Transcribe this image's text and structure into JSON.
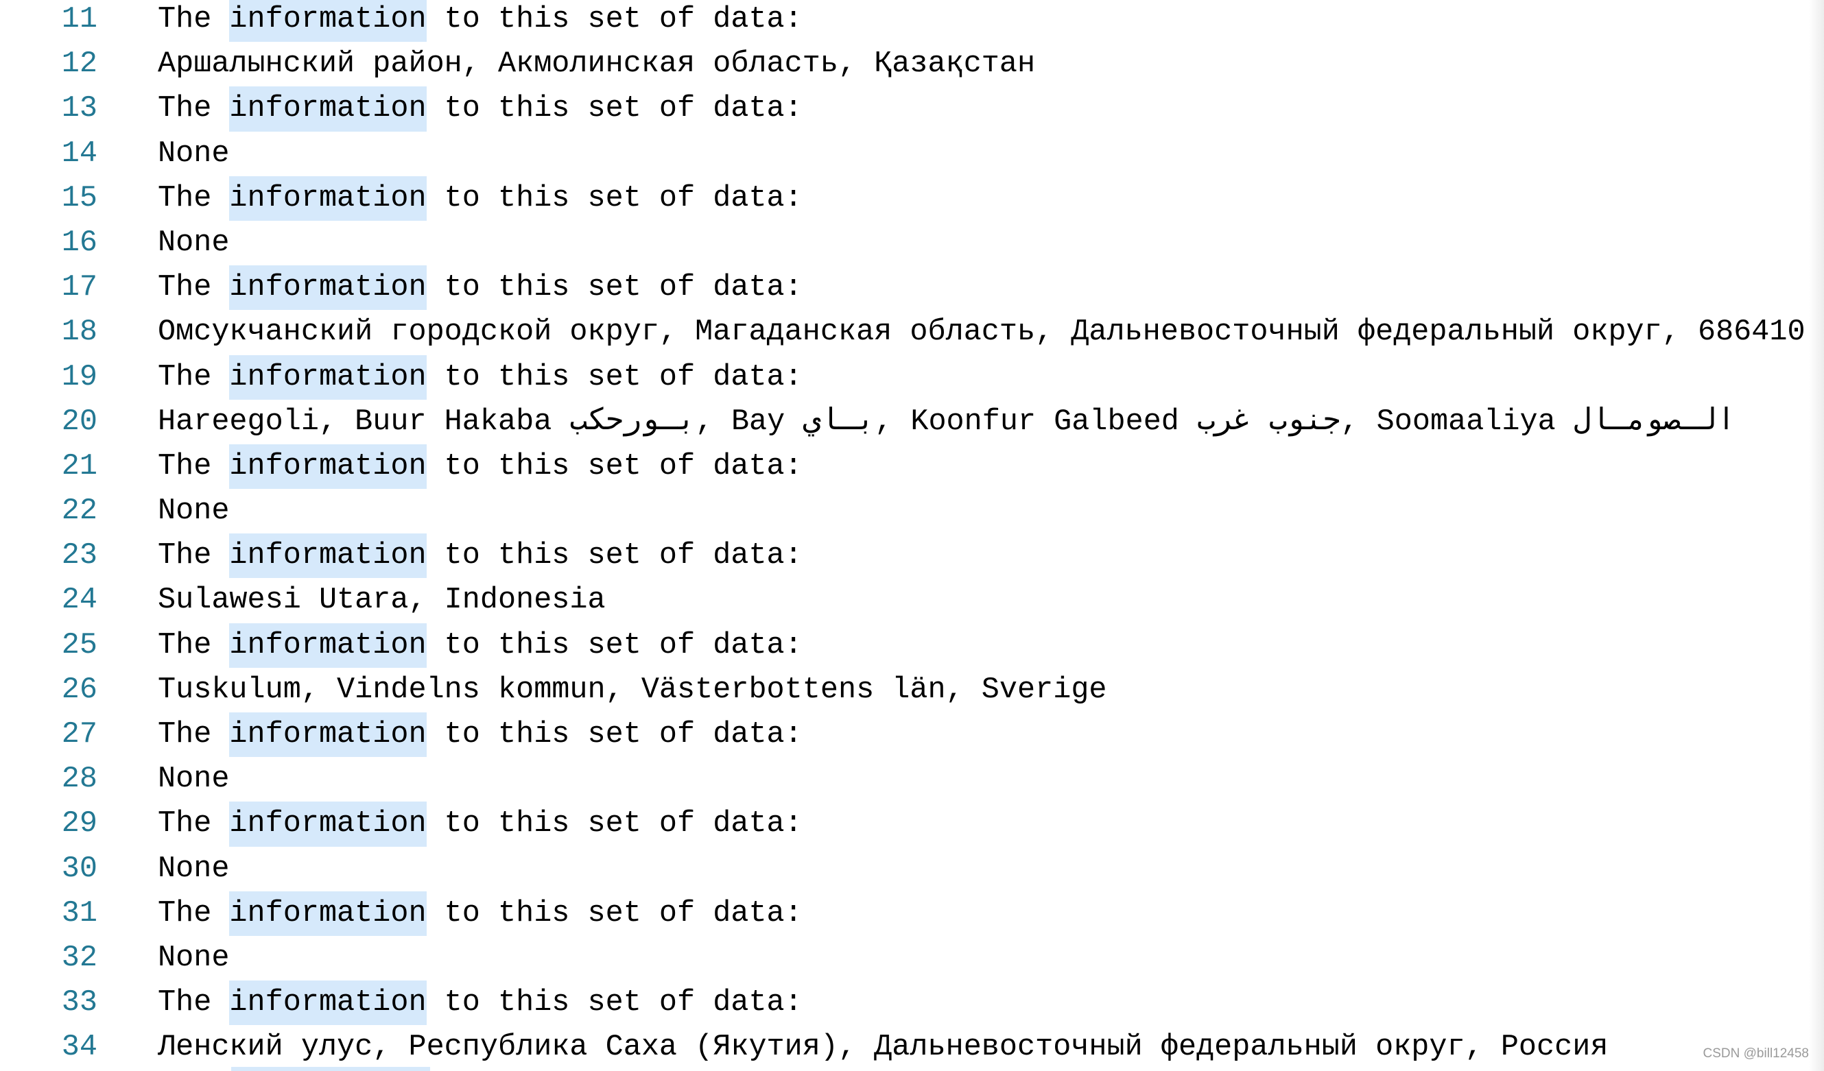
{
  "editor": {
    "highlight_color": "#d6e9fb",
    "line_number_color": "#237893",
    "highlighted_word": "information",
    "lines": [
      {
        "number": "11",
        "type": "header",
        "before": "The ",
        "highlight": "information",
        "after": " to this set of data:"
      },
      {
        "number": "12",
        "type": "value",
        "text": "Аршалынский район, Акмолинская область, Қазақстан"
      },
      {
        "number": "13",
        "type": "header",
        "before": "The ",
        "highlight": "information",
        "after": " to this set of data:"
      },
      {
        "number": "14",
        "type": "value",
        "text": "None"
      },
      {
        "number": "15",
        "type": "header",
        "before": "The ",
        "highlight": "information",
        "after": " to this set of data:"
      },
      {
        "number": "16",
        "type": "value",
        "text": "None"
      },
      {
        "number": "17",
        "type": "header",
        "before": "The ",
        "highlight": "information",
        "after": " to this set of data:"
      },
      {
        "number": "18",
        "type": "value",
        "text": "Омсукчанский городской округ, Магаданская область, Дальневосточный федеральный округ, 686410"
      },
      {
        "number": "19",
        "type": "header",
        "before": "The ",
        "highlight": "information",
        "after": " to this set of data:"
      },
      {
        "number": "20",
        "type": "value",
        "text": "Hareegoli, Buur Hakaba ⁧بـورحكب⁩, Bay ⁧بـاي⁩, Koonfur Galbeed ⁧جنوب غرب⁩, Soomaaliya ⁧الـصومـال⁩"
      },
      {
        "number": "21",
        "type": "header",
        "before": "The ",
        "highlight": "information",
        "after": " to this set of data:"
      },
      {
        "number": "22",
        "type": "value",
        "text": "None"
      },
      {
        "number": "23",
        "type": "header",
        "before": "The ",
        "highlight": "information",
        "after": " to this set of data:"
      },
      {
        "number": "24",
        "type": "value",
        "text": "Sulawesi Utara, Indonesia"
      },
      {
        "number": "25",
        "type": "header",
        "before": "The ",
        "highlight": "information",
        "after": " to this set of data:"
      },
      {
        "number": "26",
        "type": "value",
        "text": "Tuskulum, Vindelns kommun, Västerbottens län, Sverige"
      },
      {
        "number": "27",
        "type": "header",
        "before": "The ",
        "highlight": "information",
        "after": " to this set of data:"
      },
      {
        "number": "28",
        "type": "value",
        "text": "None"
      },
      {
        "number": "29",
        "type": "header",
        "before": "The ",
        "highlight": "information",
        "after": " to this set of data:"
      },
      {
        "number": "30",
        "type": "value",
        "text": "None"
      },
      {
        "number": "31",
        "type": "header",
        "before": "The ",
        "highlight": "information",
        "after": " to this set of data:"
      },
      {
        "number": "32",
        "type": "value",
        "text": "None"
      },
      {
        "number": "33",
        "type": "header",
        "before": "The ",
        "highlight": "information",
        "after": " to this set of data:"
      },
      {
        "number": "34",
        "type": "value",
        "text": "Ленский улус, Республика Саха (Якутия), Дальневосточный федеральный округ, Россия"
      }
    ]
  },
  "watermark": "CSDN @bill12458"
}
